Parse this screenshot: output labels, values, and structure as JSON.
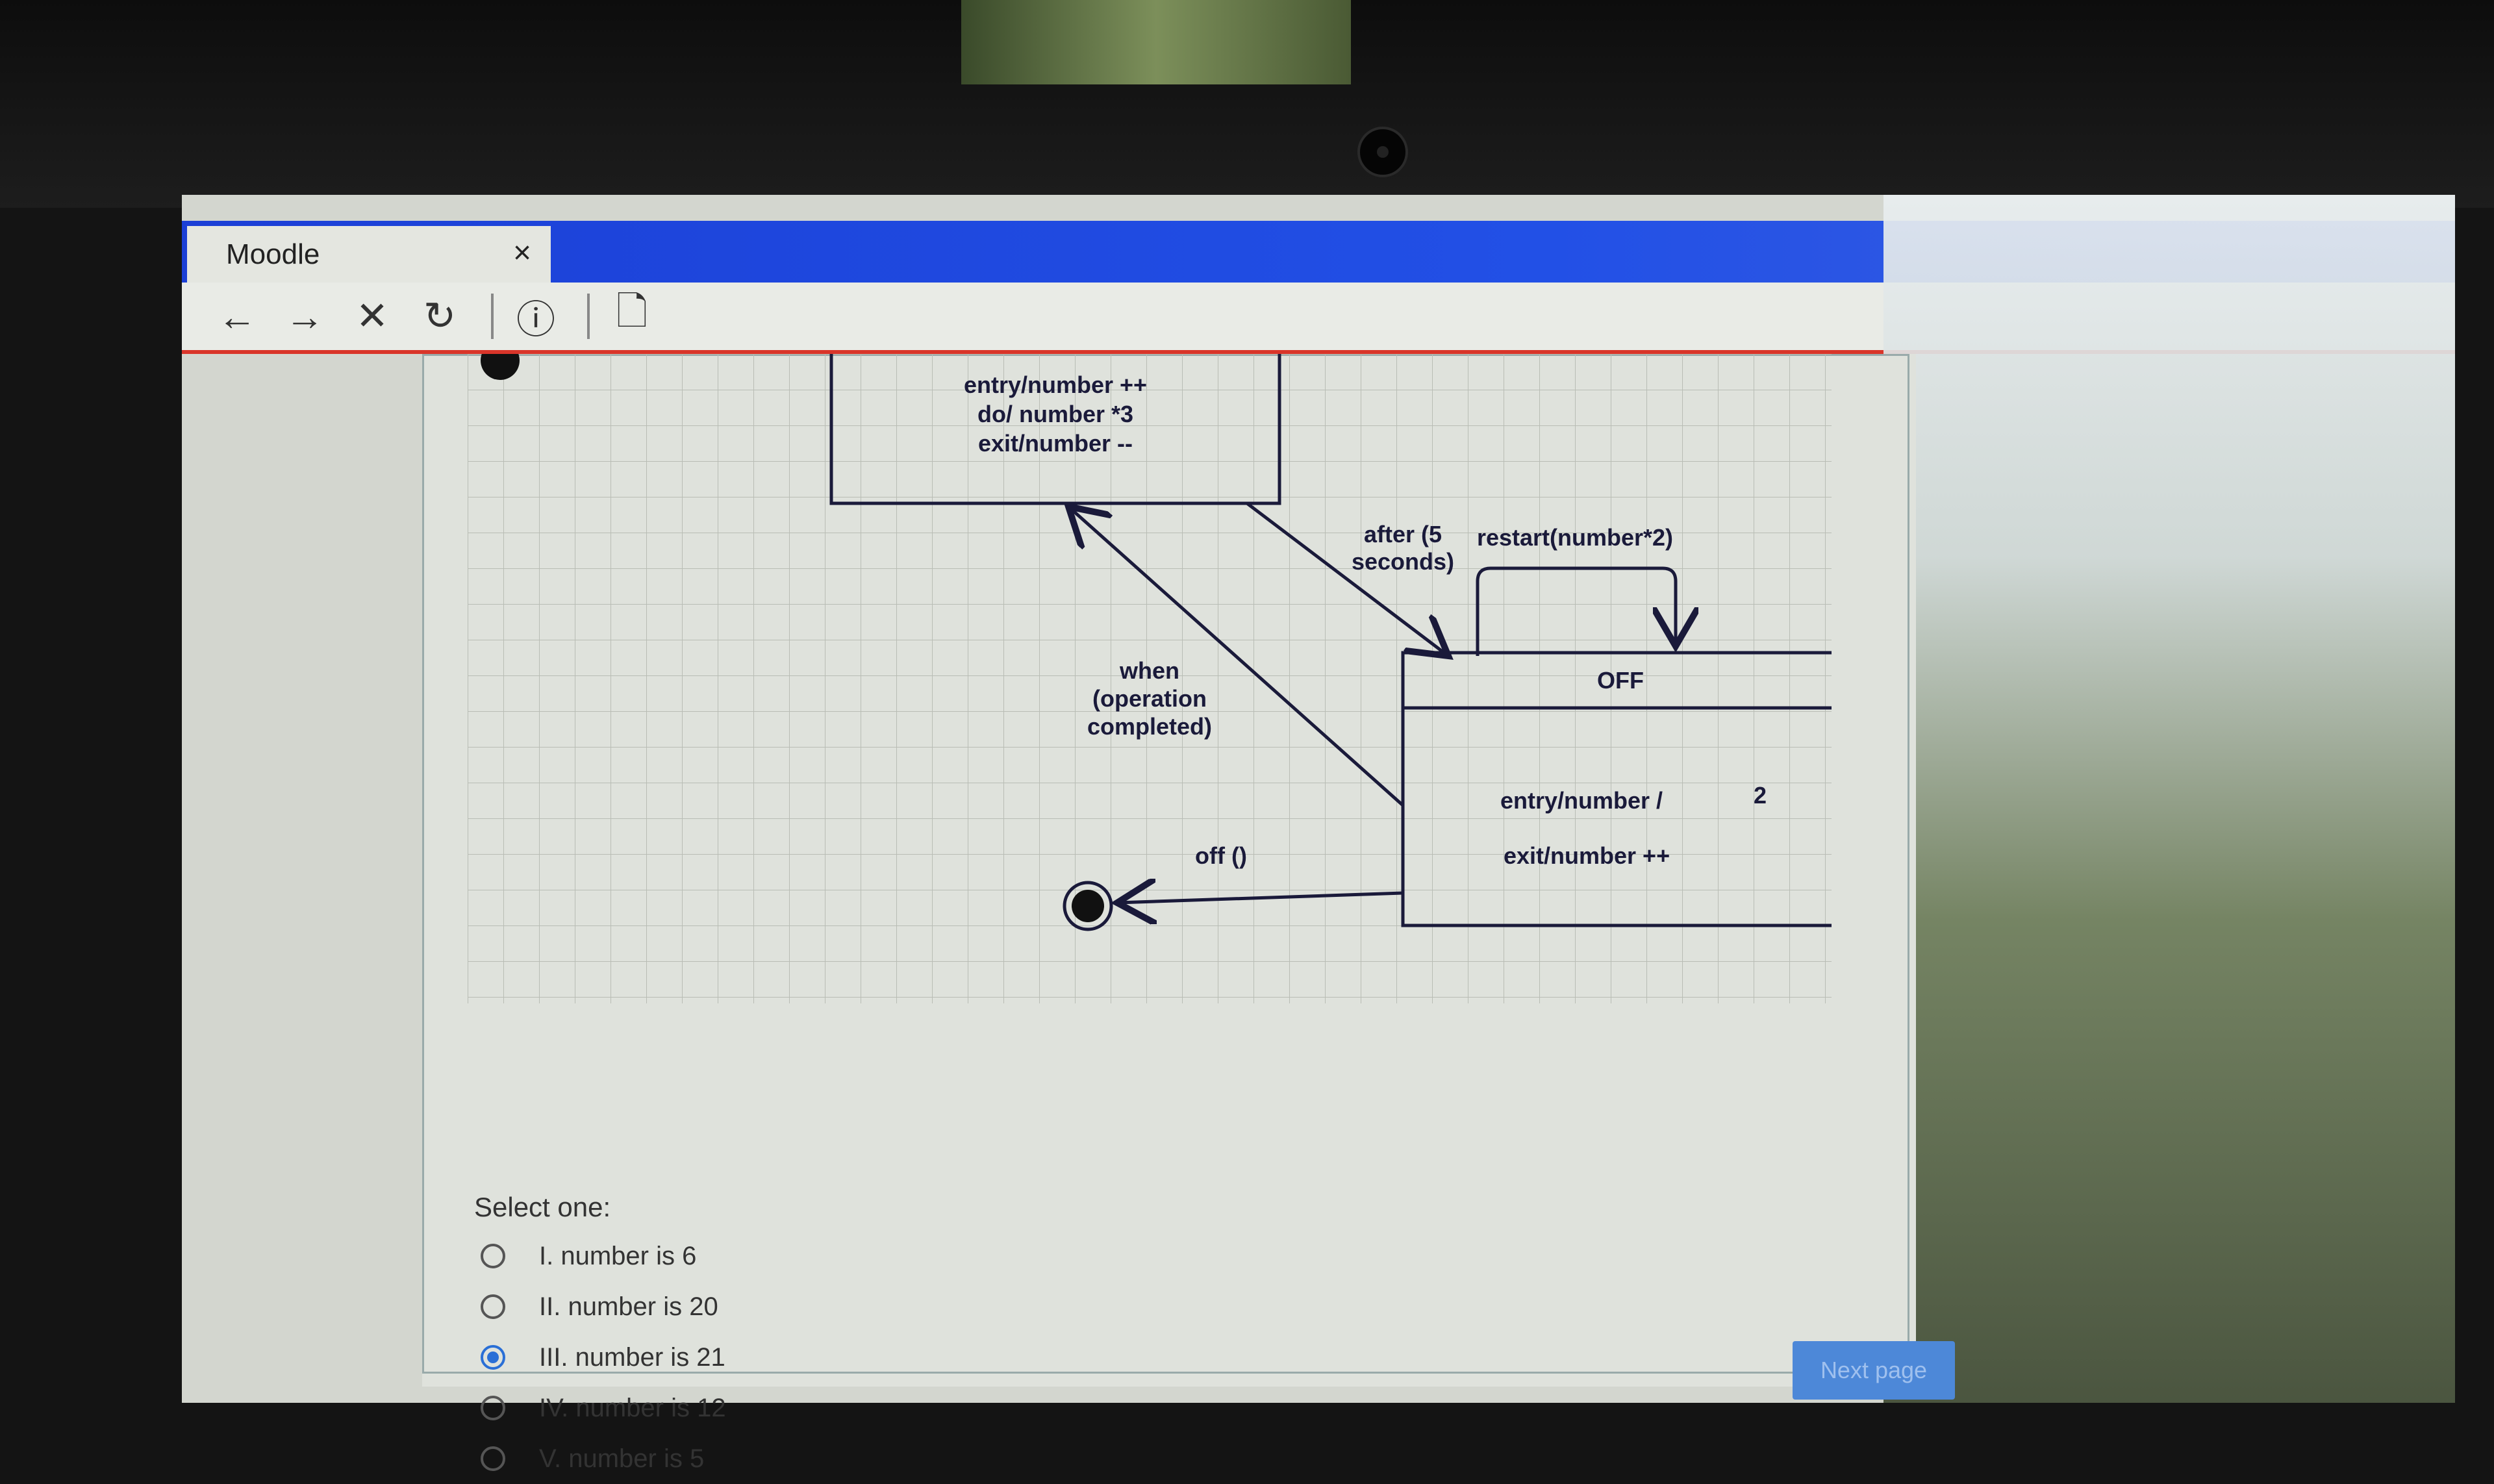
{
  "browser": {
    "tab_title": "Moodle",
    "tab_close": "×",
    "toolbar": {
      "back_icon": "←",
      "forward_icon": "→",
      "stop_icon": "✕",
      "reload_icon": "↻",
      "info_icon": "ⓘ",
      "page_icon": "🗋"
    }
  },
  "diagram": {
    "top_state": {
      "line1": "entry/number ++",
      "line2": "do/ number *3",
      "line3": "exit/number --"
    },
    "off_state": {
      "title": "OFF",
      "line1": "entry/number /",
      "line1_suffix": "2",
      "line2": "exit/number ++"
    },
    "transitions": {
      "after_line1": "after (5",
      "after_line2": "seconds)",
      "restart": "restart(number*2)",
      "when_line1": "when",
      "when_line2": "(operation",
      "when_line3": "completed)",
      "off": "off ()"
    }
  },
  "question": {
    "select_label": "Select one:",
    "options": [
      {
        "label": "I. number is 6",
        "checked": false
      },
      {
        "label": "II. number is 20",
        "checked": false
      },
      {
        "label": "III. number is 21",
        "checked": true
      },
      {
        "label": "IV. number is 12",
        "checked": false
      },
      {
        "label": "V. number is 5",
        "checked": false
      }
    ]
  },
  "footer": {
    "next_button": "Next page"
  }
}
